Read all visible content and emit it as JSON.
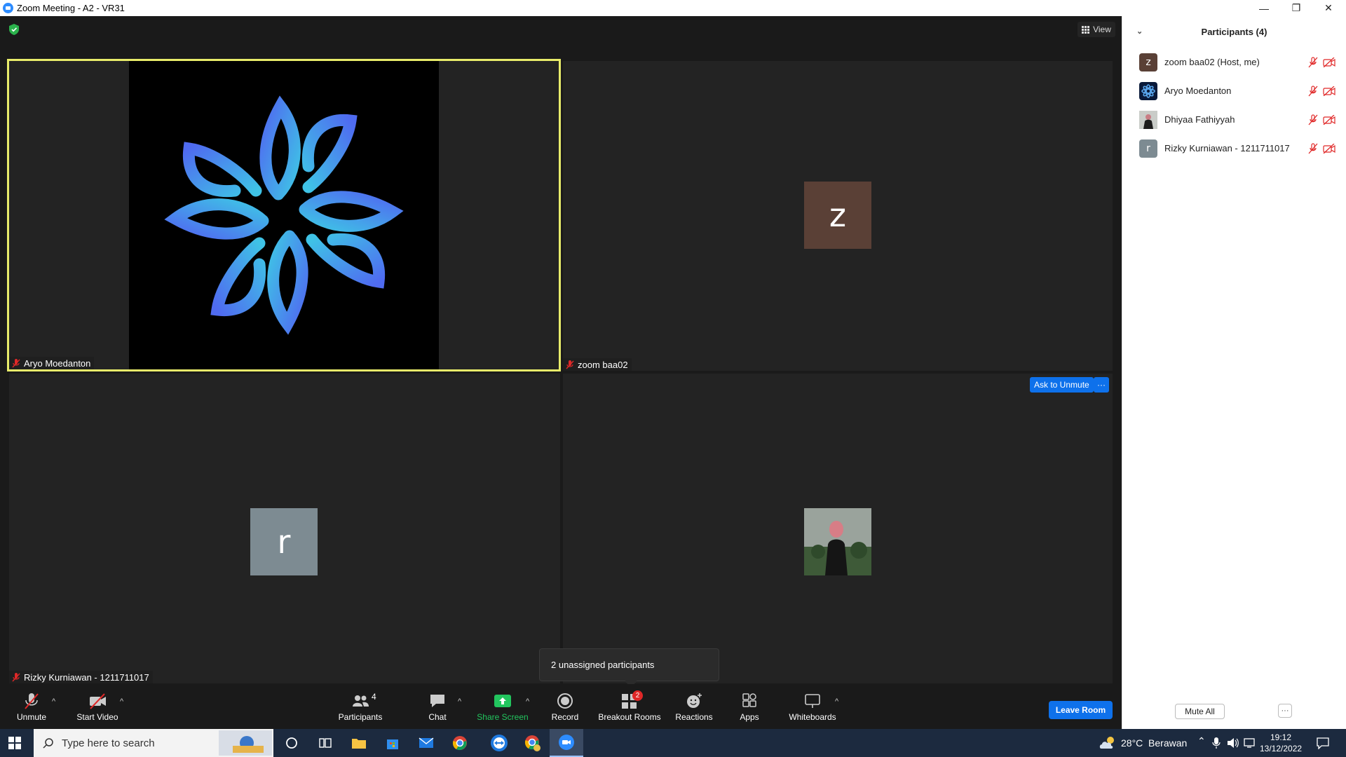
{
  "window": {
    "title": "Zoom Meeting - A2 - VR31",
    "minimize_glyph": "—",
    "restore_glyph": "❐",
    "close_glyph": "✕"
  },
  "meeting": {
    "view_label": "View",
    "tiles": [
      {
        "name": "Aryo Moedanton",
        "active_speaker": true,
        "video": "logo"
      },
      {
        "name": "zoom baa02",
        "avatar_letter": "z",
        "avatar_color": "#5a4036"
      },
      {
        "name": "Rizky Kurniawan - 1211711017",
        "avatar_letter": "r",
        "avatar_color": "#7d8b92"
      },
      {
        "name": "",
        "video": "profile-photo"
      }
    ],
    "ask_to_unmute_label": "Ask to Unmute",
    "tile_more_label": "···",
    "tooltip_text": "2 unassigned participants"
  },
  "toolbar": {
    "unmute_label": "Unmute",
    "start_video_label": "Start Video",
    "participants_label": "Participants",
    "participants_count": "4",
    "chat_label": "Chat",
    "share_screen_label": "Share Screen",
    "record_label": "Record",
    "breakout_rooms_label": "Breakout Rooms",
    "breakout_badge": "2",
    "reactions_label": "Reactions",
    "apps_label": "Apps",
    "whiteboards_label": "Whiteboards",
    "leave_room_label": "Leave Room",
    "caret": "^"
  },
  "panel": {
    "title": "Participants (4)",
    "participants": [
      {
        "name": "zoom baa02 (Host, me)",
        "avatar_letter": "z",
        "avatar_color": "#5a4036"
      },
      {
        "name": "Aryo Moedanton",
        "avatar_letter": "",
        "avatar_color": "#0a1a3a"
      },
      {
        "name": "Dhiyaa Fathiyyah",
        "avatar_letter": "",
        "avatar_color": "#8a8f88"
      },
      {
        "name": "Rizky Kurniawan - 1211711017",
        "avatar_letter": "r",
        "avatar_color": "#7d8b92"
      }
    ],
    "mute_all_label": "Mute All",
    "more_label": "···"
  },
  "taskbar": {
    "search_placeholder": "Type here to search",
    "weather": "28°C  Berawan",
    "time": "19:12",
    "date": "13/12/2022"
  },
  "colors": {
    "accent_blue": "#0e71eb",
    "speaker_border": "#e8ec6a",
    "share_green": "#22c55e",
    "muted_red": "#e02828"
  }
}
